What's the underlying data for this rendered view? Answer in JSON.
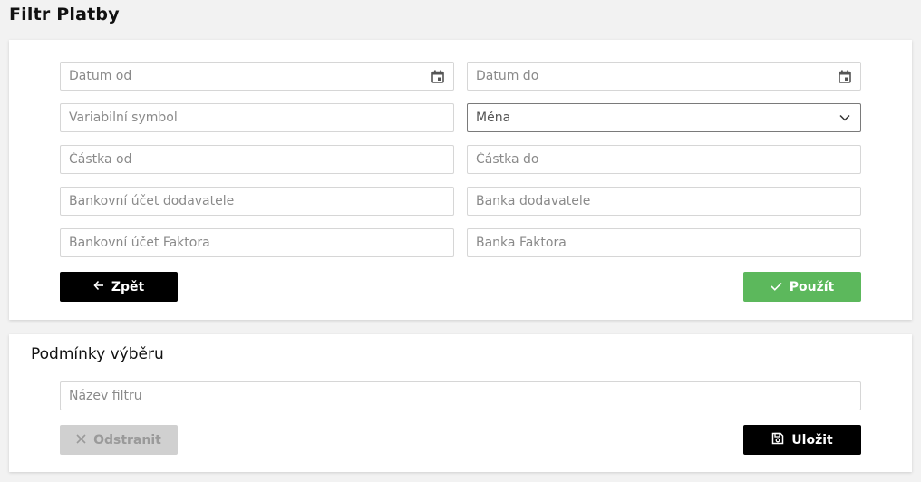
{
  "page": {
    "title": "Filtr Platby"
  },
  "filter": {
    "date_from": {
      "placeholder": "Datum od",
      "icon": "calendar-icon"
    },
    "date_to": {
      "placeholder": "Datum do",
      "icon": "calendar-icon"
    },
    "variable_symbol": {
      "placeholder": "Variabilní symbol"
    },
    "currency": {
      "placeholder": "Měna",
      "icon": "chevron-down-icon"
    },
    "amount_from": {
      "placeholder": "Částka od"
    },
    "amount_to": {
      "placeholder": "Částka do"
    },
    "supplier_account": {
      "placeholder": "Bankovní účet dodavatele"
    },
    "supplier_bank": {
      "placeholder": "Banka dodavatele"
    },
    "factor_account": {
      "placeholder": "Bankovní účet Faktora"
    },
    "factor_bank": {
      "placeholder": "Banka Faktora"
    },
    "back_label": "Zpět",
    "apply_label": "Použít"
  },
  "conditions": {
    "title": "Podmínky výběru",
    "filter_name": {
      "placeholder": "Název filtru"
    },
    "remove_label": "Odstranit",
    "save_label": "Uložit"
  },
  "colors": {
    "apply": "#5cb85c",
    "primary": "#000000",
    "disabled": "#d0d0d0"
  }
}
